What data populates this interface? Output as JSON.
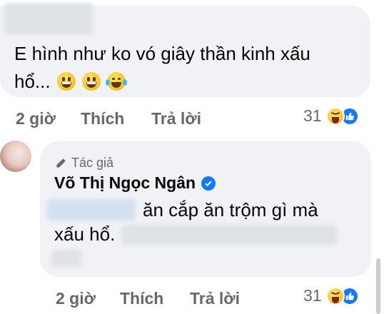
{
  "comment1": {
    "text_line1": "E hình như ko vó giây thần kinh xấu",
    "text_line2": "hổ...",
    "emojis": [
      "grinning-face",
      "grinning-face",
      "face-with-tears-of-joy"
    ],
    "time": "2 giờ",
    "like_label": "Thích",
    "reply_label": "Trả lời",
    "reaction_count": "31",
    "reaction_icons": [
      "haha-icon",
      "like-icon"
    ]
  },
  "reply": {
    "author_badge": "Tác giả",
    "author_name": "Võ Thị Ngọc Ngân",
    "text_line1": "ăn cắp ăn trộm gì mà",
    "text_line2": "xấu hổ.",
    "time": "2 giờ",
    "like_label": "Thích",
    "reply_label": "Trả lời",
    "reaction_count": "31",
    "reaction_icons": [
      "haha-icon",
      "like-icon"
    ]
  },
  "colors": {
    "bubble": "#f0f2f5",
    "secondary_text": "#65676b",
    "facebook_blue": "#1877f2"
  }
}
